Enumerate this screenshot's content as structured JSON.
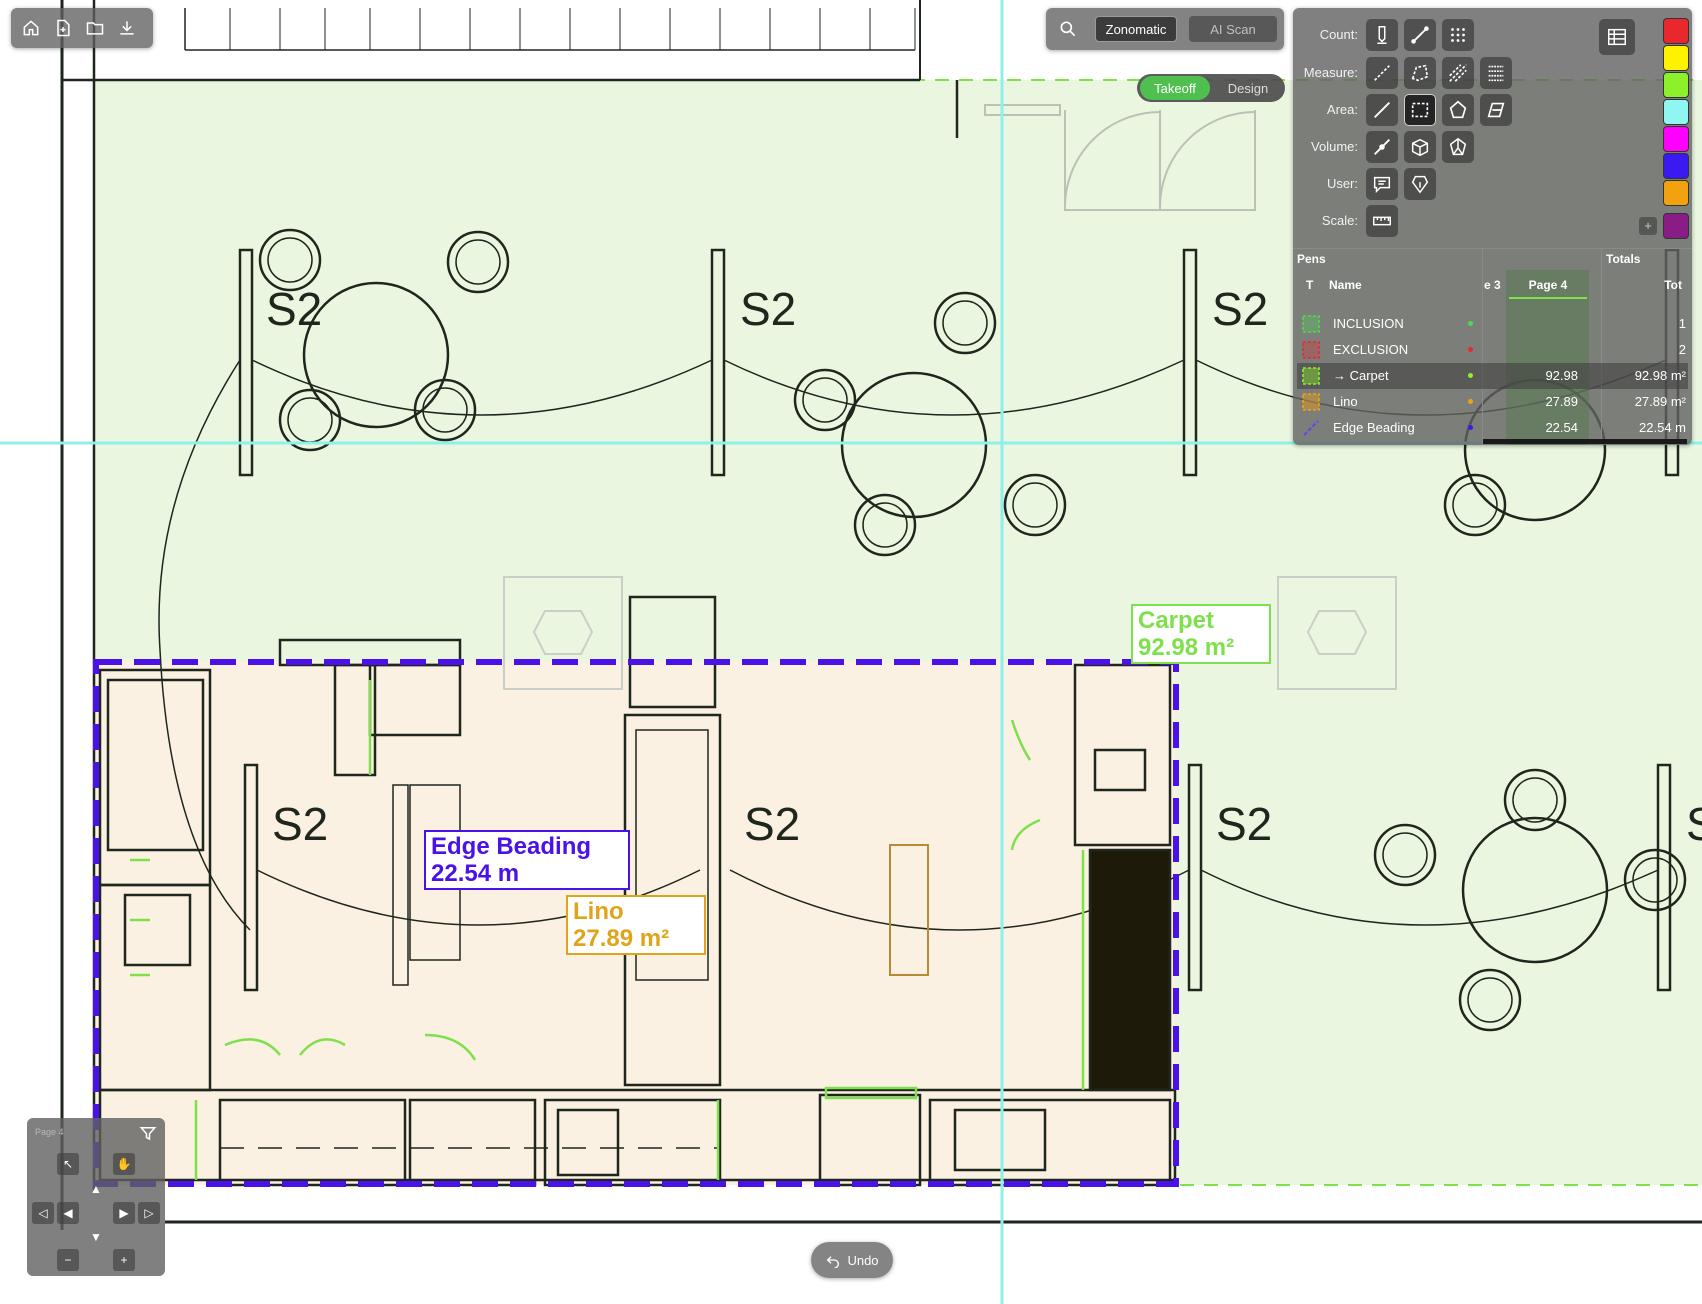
{
  "colors": {
    "carpet": "#7ee04b",
    "lino": "#e0a41a",
    "edge_beading": "#4a12e8",
    "crosshair": "#8ff0ea",
    "toolbar_bg": "#606060",
    "active_green": "#4fc04f"
  },
  "top_left_toolbar": {
    "icons": [
      "home-icon",
      "new-file-icon",
      "open-folder-icon",
      "download-icon"
    ]
  },
  "top_center_toolbar": {
    "search_icon": "search-icon",
    "zonomatic_label": "Zonomatic",
    "ai_scan_label": "AI Scan"
  },
  "mode_toggle": {
    "takeoff_label": "Takeoff",
    "design_label": "Design",
    "active": "Takeoff"
  },
  "drawing": {
    "room_tags": [
      "S2",
      "S2",
      "S2",
      "S2",
      "S2",
      "S2"
    ],
    "edge_label_partial": "S"
  },
  "measurement_labels": {
    "carpet": {
      "name": "Carpet",
      "value": "92.98 m²"
    },
    "lino": {
      "name": "Lino",
      "value": "27.89 m²"
    },
    "edge_beading": {
      "name": "Edge Beading",
      "value": "22.54 m"
    }
  },
  "tools_panel": {
    "rows": [
      {
        "label": "Count:",
        "icons": [
          "count-marker-icon",
          "count-line-icon",
          "count-grid-icon"
        ]
      },
      {
        "label": "Measure:",
        "icons": [
          "measure-line-icon",
          "measure-polyline-icon",
          "measure-multi-icon",
          "measure-list-icon"
        ]
      },
      {
        "label": "Area:",
        "icons": [
          "area-line-icon",
          "area-rectangle-icon",
          "area-polygon-icon",
          "area-slope-icon"
        ]
      },
      {
        "label": "Volume:",
        "icons": [
          "volume-line-icon",
          "volume-box-icon",
          "volume-polygon-icon"
        ]
      },
      {
        "label": "User:",
        "icons": [
          "comment-icon",
          "shield-pen-icon"
        ]
      },
      {
        "label": "Scale:",
        "icons": [
          "ruler-icon"
        ]
      }
    ],
    "table_icon": "table-view-icon",
    "add_color_label": "+",
    "swatches": [
      "#e8282d",
      "#fff200",
      "#8cf02a",
      "#8ff6f2",
      "#ff00ff",
      "#3a1af0",
      "#f2a10f",
      "#8a1c86"
    ]
  },
  "pens_panel": {
    "title": "Pens",
    "totals_title": "Totals",
    "columns": {
      "type": "T",
      "name": "Name",
      "page3": "e 3",
      "page4": "Page 4",
      "total": "Tot"
    },
    "rows": [
      {
        "name": "INCLUSION",
        "icon": "inclusion-area-icon",
        "dot": "#52d852",
        "page4": "",
        "total": "1"
      },
      {
        "name": "EXCLUSION",
        "icon": "exclusion-area-icon",
        "dot": "#e8282d",
        "page4": "",
        "total": "2"
      },
      {
        "name": "→ Carpet",
        "icon": "carpet-area-icon",
        "dot": "#8cf02a",
        "page4": "92.98",
        "total": "92.98 m²"
      },
      {
        "name": "Lino",
        "icon": "lino-area-icon",
        "dot": "#f2a10f",
        "page4": "27.89",
        "total": "27.89 m²"
      },
      {
        "name": "Edge Beading",
        "icon": "edge-line-icon",
        "dot": "#3a1af0",
        "page4": "22.54",
        "total": "22.54 m"
      }
    ]
  },
  "navigator": {
    "page_label": "Page 4",
    "filter_icon": "filter-icon",
    "zoom_out": "−",
    "zoom_in": "+"
  },
  "undo": {
    "label": "Undo",
    "icon": "undo-icon"
  }
}
